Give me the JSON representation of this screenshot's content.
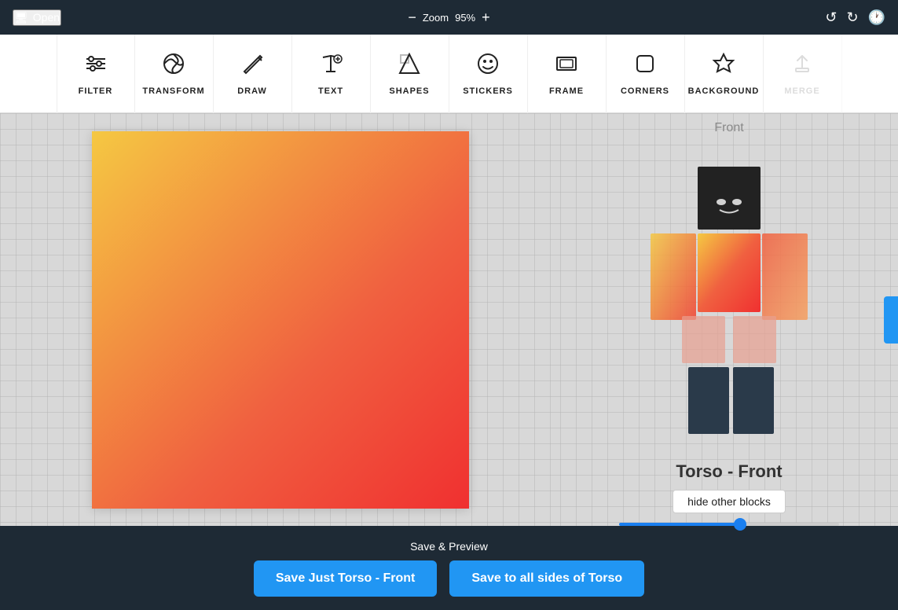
{
  "topbar": {
    "open_label": "Open",
    "zoom_label": "Zoom",
    "zoom_value": "95%",
    "zoom_minus": "−",
    "zoom_plus": "+"
  },
  "toolbar": {
    "items": [
      {
        "id": "filter",
        "label": "FILTER",
        "icon": "⚙",
        "disabled": false
      },
      {
        "id": "transform",
        "label": "TRANSFORM",
        "icon": "↻",
        "disabled": false
      },
      {
        "id": "draw",
        "label": "DRAW",
        "icon": "✏",
        "disabled": false
      },
      {
        "id": "text",
        "label": "TEXT",
        "icon": "A+",
        "disabled": false
      },
      {
        "id": "shapes",
        "label": "SHAPES",
        "icon": "⬡",
        "disabled": false
      },
      {
        "id": "stickers",
        "label": "STICKERS",
        "icon": "☺",
        "disabled": false
      },
      {
        "id": "frame",
        "label": "FRAME",
        "icon": "▭",
        "disabled": false
      },
      {
        "id": "corners",
        "label": "CORNERS",
        "icon": "▢",
        "disabled": false
      },
      {
        "id": "background",
        "label": "BACKGROUND",
        "icon": "◆",
        "disabled": false
      },
      {
        "id": "merge",
        "label": "MERGE",
        "icon": "↑",
        "disabled": true
      }
    ]
  },
  "preview": {
    "direction_label": "Front",
    "part_label": "Torso - Front",
    "hide_btn_label": "hide other blocks"
  },
  "bottom": {
    "save_preview_label": "Save & Preview",
    "save_just_label": "Save Just Torso - Front",
    "save_all_label": "Save to all sides of Torso"
  }
}
